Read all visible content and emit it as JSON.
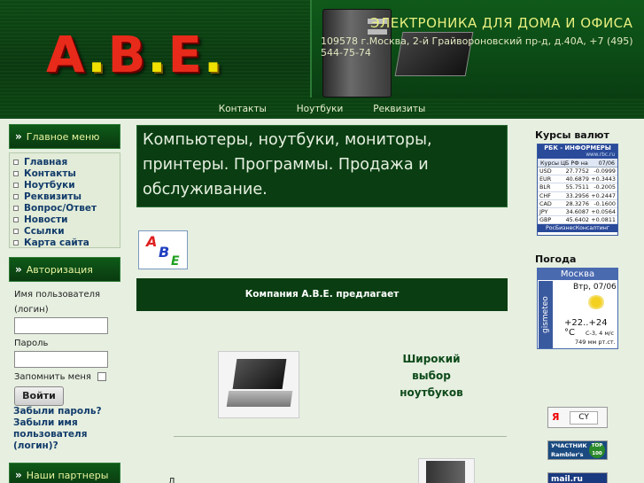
{
  "header": {
    "logo": {
      "a": "A",
      "b": "B",
      "e": "E"
    },
    "tagline": "ЭЛЕКТРОНИКА ДЛЯ ДОМА И ОФИСА",
    "address": "109578 г.Москва, 2-й Грайвороновский пр-д, д.40А, +7 (495) 544-75-74",
    "nav": [
      "Контакты",
      "Ноутбуки",
      "Реквизиты"
    ]
  },
  "sidebar": {
    "main_menu_title": "Главное меню",
    "main_menu": [
      "Главная",
      "Контакты",
      "Ноутбуки",
      "Реквизиты",
      "Вопрос/Ответ",
      "Новости",
      "Ссылки",
      "Карта сайта"
    ],
    "auth_title": "Авторизация",
    "username_label": "Имя пользователя (логин)",
    "password_label": "Пароль",
    "remember_label": "Запомнить меня",
    "login_button": "Войти",
    "forgot_password": "Забыли пароль?",
    "forgot_username": "Забыли имя пользователя (логин)?",
    "partners_title": "Наши партнеры"
  },
  "main": {
    "hero": "Компьютеры, ноутбуки, мониторы, принтеры. Программы. Продажа и обслуживание.",
    "abc_logo": {
      "a": "А",
      "b": "В",
      "c": "Е"
    },
    "offer_title": "Компания А.В.Е. предлагает",
    "laptops_caption": "Широкий выбор ноутбуков",
    "bottom_fragment": "Д"
  },
  "right": {
    "rates_title": "Курсы валют",
    "rates_widget": {
      "header": "РБК - ИНФОРМЕРЫ",
      "url": "www.rbc.ru",
      "subheader": "Курсы ЦБ РФ на",
      "date": "07/06",
      "rows": [
        {
          "code": "USD",
          "value": "27.7752",
          "change": "-0.0999"
        },
        {
          "code": "EUR",
          "value": "40.6879",
          "change": "+0.3443"
        },
        {
          "code": "BLR",
          "value": "55.7511",
          "change": "-0.2005"
        },
        {
          "code": "CHF",
          "value": "33.2956",
          "change": "+0.2447"
        },
        {
          "code": "CAD",
          "value": "28.3276",
          "change": "-0.1600"
        },
        {
          "code": "JPY",
          "value": "34.6087",
          "change": "+0.0564"
        },
        {
          "code": "GBP",
          "value": "45.6402",
          "change": "+0.0811"
        }
      ],
      "footer": "РосБизнесКонсалтинг"
    },
    "weather_title": "Погода",
    "weather_widget": {
      "city": "Москва",
      "brand": "gismeteo",
      "date": "Втр, 07/06",
      "temp": "+22..+24 °C",
      "wind": "С-3, 4 м/с",
      "pressure": "749 мм рт.ст."
    },
    "badges": {
      "ya_letter": "Я",
      "ya_counter": "CY",
      "rambler": "УЧАСТНИК Rambler's",
      "rambler_top": "TOP 100",
      "mail": "mail.ru"
    }
  }
}
